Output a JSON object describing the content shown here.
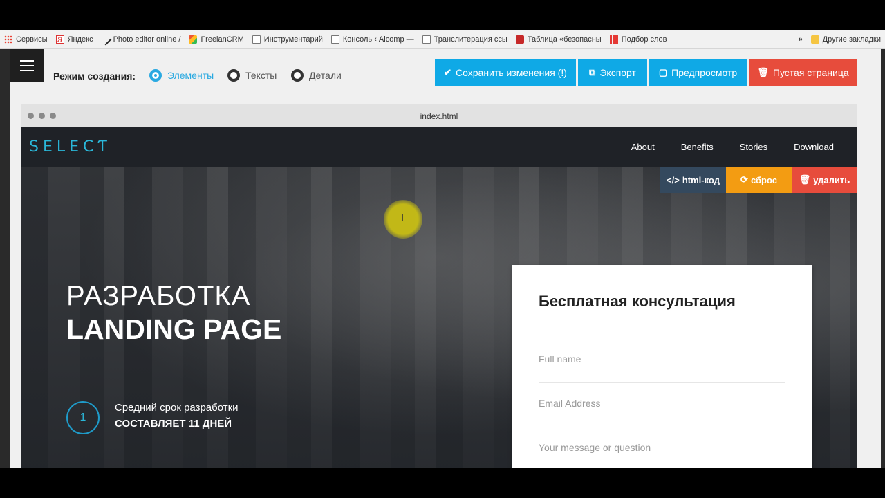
{
  "bookmarks": [
    {
      "label": "Сервисы",
      "icon": "apps-icon"
    },
    {
      "label": "Яндекс",
      "icon": "yandex-icon"
    },
    {
      "label": "Photo editor online /",
      "icon": "pen-icon"
    },
    {
      "label": "FreelanCRM",
      "icon": "freelancrm-icon"
    },
    {
      "label": "Инструментарий",
      "icon": "page-icon"
    },
    {
      "label": "Консоль ‹ Alcomp —",
      "icon": "page-icon"
    },
    {
      "label": "Транслитерация ссы",
      "icon": "page-icon"
    },
    {
      "label": "Таблица «безопасны",
      "icon": "table-icon"
    },
    {
      "label": "Подбор слов",
      "icon": "chart-icon"
    }
  ],
  "bookmarks_more": "»",
  "other_bookmarks": "Другие закладки",
  "toolbar": {
    "mode_label": "Режим создания:",
    "modes": [
      "Элементы",
      "Тексты",
      "Детали"
    ],
    "active_mode": "Элементы",
    "save": "Сохранить изменения (!)",
    "export": "Экспорт",
    "preview": "Предпросмотр",
    "blank": "Пустая страница"
  },
  "frame": {
    "filename": "index.html"
  },
  "site": {
    "logo": "SELECƬ",
    "nav": [
      "About",
      "Benefits",
      "Stories",
      "Download"
    ]
  },
  "edit_tools": {
    "html": "html-код",
    "reset": "сброс",
    "delete": "удалить"
  },
  "hero": {
    "title_light": "РАЗРАБОТКА",
    "title_bold": "LANDING PAGE",
    "step_number": "1",
    "step_text": "Средний срок разработки",
    "step_value": "СОСТАВЛЯЕТ 11 ДНЕЙ"
  },
  "form": {
    "title": "Бесплатная консультация",
    "name_placeholder": "Full name",
    "email_placeholder": "Email Address",
    "message_placeholder": "Your message or question"
  },
  "colors": {
    "accent_blue": "#0fa9e6",
    "danger_red": "#e74c3c",
    "warning_orange": "#f39c12",
    "dark_slate": "#34495e",
    "logo_cyan": "#2ab7d8"
  }
}
